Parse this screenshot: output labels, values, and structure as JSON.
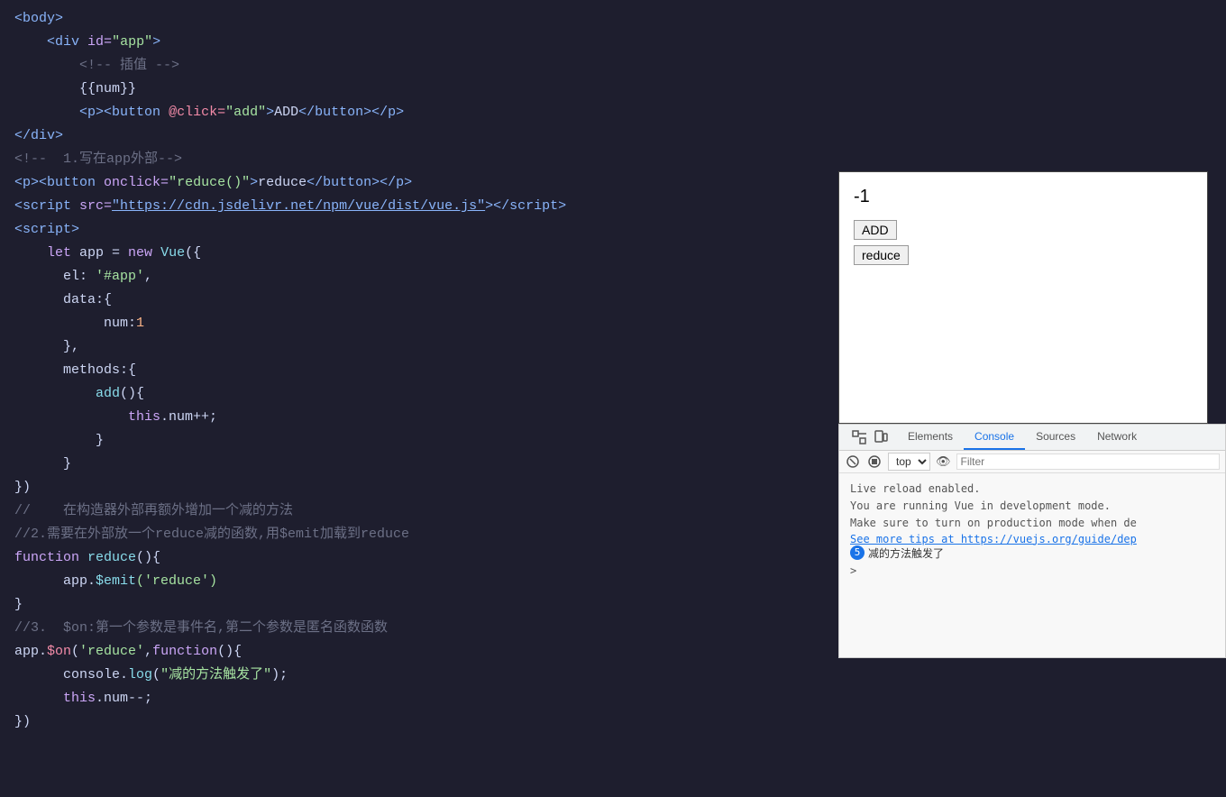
{
  "editor": {
    "lines": [
      {
        "id": "l1",
        "indent": 0,
        "tokens": [
          {
            "type": "tag",
            "text": "<body>"
          }
        ]
      },
      {
        "id": "l2",
        "indent": 1,
        "tokens": [
          {
            "type": "tag",
            "text": "<div"
          },
          {
            "type": "plain",
            "text": " "
          },
          {
            "type": "attr-name",
            "text": "id="
          },
          {
            "type": "attr-value",
            "text": "\"app\""
          },
          {
            "type": "tag",
            "text": ">"
          }
        ]
      },
      {
        "id": "l3",
        "indent": 2,
        "tokens": [
          {
            "type": "comment",
            "text": "<!-- 插值 -->"
          }
        ]
      },
      {
        "id": "l4",
        "indent": 2,
        "tokens": [
          {
            "type": "mustache",
            "text": "{{num}}"
          }
        ]
      },
      {
        "id": "l5",
        "indent": 2,
        "tokens": [
          {
            "type": "tag",
            "text": "<p>"
          },
          {
            "type": "tag",
            "text": "<button"
          },
          {
            "type": "plain",
            "text": " "
          },
          {
            "type": "event",
            "text": "@click="
          },
          {
            "type": "attr-value",
            "text": "\"add\""
          },
          {
            "type": "tag",
            "text": ">"
          },
          {
            "type": "plain",
            "text": "ADD"
          },
          {
            "type": "tag",
            "text": "</button>"
          },
          {
            "type": "tag",
            "text": "</p>"
          }
        ]
      },
      {
        "id": "l6",
        "indent": 0,
        "tokens": [
          {
            "type": "tag",
            "text": "</div>"
          }
        ]
      },
      {
        "id": "l7",
        "indent": 0,
        "tokens": [
          {
            "type": "comment",
            "text": "<!--  1.写在app外部-->"
          }
        ]
      },
      {
        "id": "l8",
        "indent": 0,
        "tokens": [
          {
            "type": "tag",
            "text": "<p>"
          },
          {
            "type": "tag",
            "text": "<button"
          },
          {
            "type": "plain",
            "text": " "
          },
          {
            "type": "attr-name",
            "text": "onclick="
          },
          {
            "type": "attr-value",
            "text": "\"reduce()\""
          },
          {
            "type": "tag",
            "text": ">"
          },
          {
            "type": "plain",
            "text": "reduce"
          },
          {
            "type": "tag",
            "text": "</button>"
          },
          {
            "type": "tag",
            "text": "</p>"
          }
        ]
      },
      {
        "id": "l9",
        "indent": 0,
        "tokens": [
          {
            "type": "tag",
            "text": "<script"
          },
          {
            "type": "plain",
            "text": " "
          },
          {
            "type": "attr-name",
            "text": "src="
          },
          {
            "type": "url-link",
            "text": "\"https://cdn.jsdelivr.net/npm/vue/dist/vue.js\""
          },
          {
            "type": "tag",
            "text": "></"
          },
          {
            "type": "tag",
            "text": "script>"
          }
        ]
      },
      {
        "id": "l10",
        "indent": 0,
        "tokens": [
          {
            "type": "tag",
            "text": "<script>"
          }
        ]
      },
      {
        "id": "l11",
        "indent": 1,
        "tokens": [
          {
            "type": "js-keyword",
            "text": "let"
          },
          {
            "type": "plain",
            "text": " app = "
          },
          {
            "type": "js-keyword",
            "text": "new"
          },
          {
            "type": "plain",
            "text": " "
          },
          {
            "type": "js-func",
            "text": "Vue"
          },
          {
            "type": "plain",
            "text": "({"
          }
        ]
      },
      {
        "id": "l12",
        "indent": 2,
        "tokens": [
          {
            "type": "plain",
            "text": "el: "
          },
          {
            "type": "js-string",
            "text": "'#app'"
          },
          {
            "type": "plain",
            "text": ","
          }
        ]
      },
      {
        "id": "l13",
        "indent": 2,
        "tokens": [
          {
            "type": "plain",
            "text": "data:{"
          }
        ]
      },
      {
        "id": "l14",
        "indent": 3,
        "tokens": [
          {
            "type": "plain",
            "text": "num:"
          },
          {
            "type": "js-number",
            "text": "1"
          }
        ]
      },
      {
        "id": "l15",
        "indent": 2,
        "tokens": [
          {
            "type": "plain",
            "text": "},"
          }
        ]
      },
      {
        "id": "l16",
        "indent": 2,
        "tokens": [
          {
            "type": "plain",
            "text": "methods:{"
          }
        ]
      },
      {
        "id": "l17",
        "indent": 3,
        "tokens": [
          {
            "type": "js-func",
            "text": "add"
          },
          {
            "type": "plain",
            "text": "(){"
          }
        ]
      },
      {
        "id": "l18",
        "indent": 4,
        "tokens": [
          {
            "type": "js-keyword",
            "text": "this"
          },
          {
            "type": "plain",
            "text": ".num++;"
          }
        ]
      },
      {
        "id": "l19",
        "indent": 3,
        "tokens": [
          {
            "type": "plain",
            "text": "}"
          }
        ]
      },
      {
        "id": "l20",
        "indent": 2,
        "tokens": [
          {
            "type": "plain",
            "text": "}"
          }
        ]
      },
      {
        "id": "l21",
        "indent": 0,
        "tokens": [
          {
            "type": "plain",
            "text": "})"
          }
        ]
      },
      {
        "id": "l22",
        "indent": 0,
        "tokens": [
          {
            "type": "js-comment",
            "text": "//    在构造器外部再额外增加一个减的方法"
          }
        ]
      },
      {
        "id": "l23",
        "indent": 0,
        "tokens": [
          {
            "type": "js-comment",
            "text": "//2.需要在外部放一个reduce减的函数,用$emit加载到reduce"
          }
        ]
      },
      {
        "id": "l24",
        "indent": 0,
        "tokens": [
          {
            "type": "js-keyword",
            "text": "function"
          },
          {
            "type": "plain",
            "text": " "
          },
          {
            "type": "js-func",
            "text": "reduce"
          },
          {
            "type": "plain",
            "text": "(){"
          }
        ]
      },
      {
        "id": "l25",
        "indent": 1,
        "tokens": [
          {
            "type": "plain",
            "text": "app."
          },
          {
            "type": "emit-method",
            "text": "$emit"
          },
          {
            "type": "js-string",
            "text": "('reduce')"
          }
        ]
      },
      {
        "id": "l26",
        "indent": 0,
        "tokens": [
          {
            "type": "plain",
            "text": "}"
          }
        ]
      },
      {
        "id": "l27",
        "indent": 0,
        "tokens": [
          {
            "type": "js-comment",
            "text": "//3.  $on:第一个参数是事件名,第二个参数是匿名函数函数"
          }
        ]
      },
      {
        "id": "l28",
        "indent": 0,
        "tokens": [
          {
            "type": "plain",
            "text": "app."
          },
          {
            "type": "js-property",
            "text": "$on"
          },
          {
            "type": "plain",
            "text": "("
          },
          {
            "type": "js-string",
            "text": "'reduce'"
          },
          {
            "type": "plain",
            "text": ","
          },
          {
            "type": "js-keyword",
            "text": "function"
          },
          {
            "type": "plain",
            "text": "(){"
          }
        ]
      },
      {
        "id": "l29",
        "indent": 1,
        "tokens": [
          {
            "type": "plain",
            "text": "console."
          },
          {
            "type": "js-func",
            "text": "log"
          },
          {
            "type": "plain",
            "text": "("
          },
          {
            "type": "js-string",
            "text": "\"减的方法触发了\""
          },
          {
            "type": "plain",
            "text": ");"
          }
        ]
      },
      {
        "id": "l30",
        "indent": 1,
        "tokens": [
          {
            "type": "js-keyword",
            "text": "this"
          },
          {
            "type": "plain",
            "text": ".num--;"
          }
        ]
      },
      {
        "id": "l31",
        "indent": 0,
        "tokens": [
          {
            "type": "plain",
            "text": "})"
          }
        ]
      }
    ]
  },
  "preview": {
    "number": "-1",
    "add_label": "ADD",
    "reduce_label": "reduce"
  },
  "devtools": {
    "tabs": [
      "Elements",
      "Console",
      "Sources",
      "Network"
    ],
    "active_tab": "Console",
    "context": "top",
    "filter_placeholder": "Filter",
    "lines": [
      {
        "type": "info",
        "text": "Live reload enabled."
      },
      {
        "type": "info",
        "text": "You are running Vue in development mode."
      },
      {
        "type": "info",
        "text": "Make sure to turn on production mode when de"
      },
      {
        "type": "link",
        "text": "See more tips at https://vuejs.org/guide/dep"
      },
      {
        "type": "error",
        "badge": "5",
        "text": "减的方法触发了"
      },
      {
        "type": "prompt",
        "text": ">"
      }
    ]
  }
}
